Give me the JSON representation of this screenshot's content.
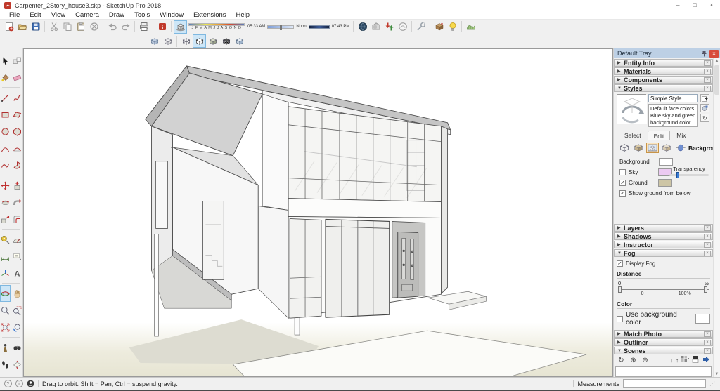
{
  "window": {
    "title": "Carpenter_2Story_house3.skp - SketchUp Pro 2018",
    "controls": {
      "minimize": "–",
      "maximize": "□",
      "close": "×"
    }
  },
  "menu": {
    "items": [
      "File",
      "Edit",
      "View",
      "Camera",
      "Draw",
      "Tools",
      "Window",
      "Extensions",
      "Help"
    ]
  },
  "toolbars": {
    "standard_icons": [
      "new",
      "open",
      "save",
      "cut",
      "copy",
      "paste",
      "erase",
      "undo",
      "redo",
      "print",
      "model-info"
    ],
    "shadow": {
      "toggle_icon": "toggle-shadows",
      "months": "J F M A M J J A S O N D",
      "time_start": "05:33 AM",
      "time_noon": "Noon",
      "time_end": "07:43 PM"
    },
    "warehouse_icons": [
      "add-location",
      "photo-textures",
      "get-models",
      "extension-warehouse",
      "preferences",
      "paint-models",
      "generate-report",
      "sandbox"
    ],
    "styles_icons": [
      "x-ray",
      "back-edges",
      "wireframe",
      "hidden-line",
      "shaded",
      "shaded-with-textures",
      "monochrome"
    ],
    "active_style": "hidden-line"
  },
  "tool_palette": {
    "tools": [
      "select",
      "make-component",
      "paint-bucket",
      "eraser",
      "line",
      "freehand",
      "rectangle",
      "rotated-rectangle",
      "circle",
      "polygon",
      "arc",
      "two-point-arc",
      "three-point-arc",
      "pie",
      "move",
      "push-pull",
      "rotate",
      "follow-me",
      "scale",
      "offset",
      "tape-measure",
      "protractor",
      "dimension",
      "text",
      "axes",
      "3d-text",
      "orbit",
      "pan",
      "zoom",
      "zoom-window",
      "zoom-extents",
      "previous",
      "position-camera",
      "look-around",
      "walk",
      "section-plane"
    ],
    "active_tool": "orbit"
  },
  "tray": {
    "title": "Default Tray",
    "sections": {
      "entity_info": "Entity Info",
      "materials": "Materials",
      "components": "Components",
      "styles": "Styles",
      "layers": "Layers",
      "shadows": "Shadows",
      "instructor": "Instructor",
      "fog": "Fog",
      "match_photo": "Match Photo",
      "outliner": "Outliner",
      "scenes": "Scenes"
    },
    "styles_panel": {
      "style_name": "Simple Style",
      "style_description": "Default face colors. Blue sky and green background color.",
      "tabs": [
        "Select",
        "Edit",
        "Mix"
      ],
      "active_tab": "Edit",
      "edit_icons": [
        "edge-settings",
        "face-settings",
        "background-settings",
        "watermark-settings",
        "modeling-settings"
      ],
      "active_edit_icon": "background-settings",
      "edit_mode_label": "Background",
      "background_label": "Background",
      "sky_label": "Sky",
      "ground_label": "Ground",
      "transparency_label": "Transparency",
      "show_ground_label": "Show ground from below",
      "sky_checked": false,
      "ground_checked": true,
      "show_ground_checked": true,
      "swatches": {
        "background": "#ffffff",
        "sky": "#eccaf2",
        "ground": "#cdc5a5"
      }
    },
    "fog_panel": {
      "display_label": "Display Fog",
      "display_checked": true,
      "distance_label": "Distance",
      "range_min": "0",
      "range_max": "∞",
      "tick_left": "0",
      "tick_right": "100%",
      "color_label": "Color",
      "use_background_label": "Use background color",
      "use_background_checked": false,
      "color_swatch": "#ffffff"
    },
    "scenes_icons": [
      "update-scene",
      "add-scene",
      "remove-scene",
      "move-scene-down",
      "move-scene-up",
      "view-options",
      "show-details",
      "hide-panel"
    ]
  },
  "statusbar": {
    "hint": "Drag to orbit. Shift = Pan, Ctrl = suspend gravity.",
    "measurements_label": "Measurements",
    "measurements_value": ""
  }
}
